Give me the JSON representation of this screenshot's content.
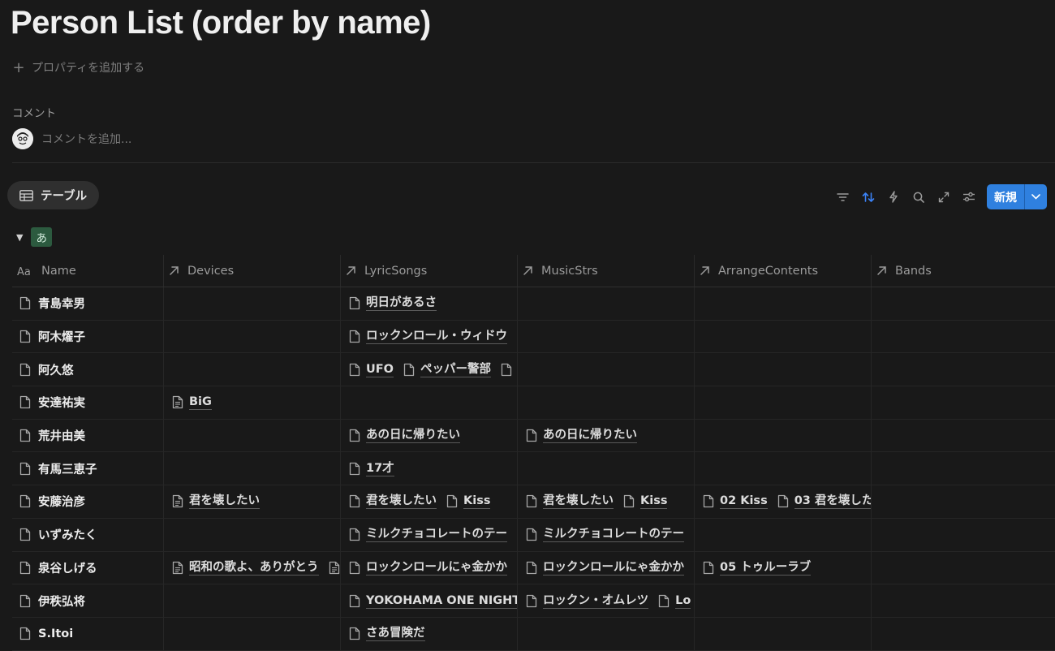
{
  "page": {
    "title": "Person List (order by name)"
  },
  "add_property": {
    "label": "プロパティを追加する"
  },
  "comments": {
    "label": "コメント",
    "placeholder": "コメントを追加..."
  },
  "view": {
    "tab_label": "テーブル"
  },
  "toolbar": {
    "new_label": "新規",
    "sort_active_color": "#3b82f6",
    "button_color": "#2f80df"
  },
  "group": {
    "label": "あ",
    "color": "#2c5a3f"
  },
  "table": {
    "columns": [
      {
        "label": "Name",
        "icon": "aa-text-icon"
      },
      {
        "label": "Devices",
        "icon": "relation-arrow-icon"
      },
      {
        "label": "LyricSongs",
        "icon": "relation-arrow-icon"
      },
      {
        "label": "MusicStrs",
        "icon": "relation-arrow-icon"
      },
      {
        "label": "ArrangeContents",
        "icon": "relation-arrow-icon"
      },
      {
        "label": "Bands",
        "icon": "relation-arrow-icon"
      }
    ],
    "rows": [
      {
        "name": "青島幸男",
        "devices": [],
        "lyric": [
          "明日があるさ"
        ],
        "music": [],
        "arrange": [],
        "bands": []
      },
      {
        "name": "阿木燿子",
        "devices": [],
        "lyric": [
          "ロックンロール・ウィドウ"
        ],
        "music": [],
        "arrange": [],
        "bands": []
      },
      {
        "name": "阿久悠",
        "devices": [],
        "lyric": [
          "UFO",
          "ペッパー警部",
          ""
        ],
        "music": [],
        "arrange": [],
        "bands": []
      },
      {
        "name": "安達祐実",
        "devices": [
          "BiG"
        ],
        "lyric": [],
        "music": [],
        "arrange": [],
        "bands": []
      },
      {
        "name": "荒井由美",
        "devices": [],
        "lyric": [
          "あの日に帰りたい"
        ],
        "music": [
          "あの日に帰りたい"
        ],
        "arrange": [],
        "bands": []
      },
      {
        "name": "有馬三恵子",
        "devices": [],
        "lyric": [
          "17才"
        ],
        "music": [],
        "arrange": [],
        "bands": []
      },
      {
        "name": "安藤治彦",
        "devices": [
          "君を壊したい"
        ],
        "lyric": [
          "君を壊したい",
          "Kiss"
        ],
        "music": [
          "君を壊したい",
          "Kiss"
        ],
        "arrange": [
          "02 Kiss",
          "03 君を壊した"
        ],
        "bands": []
      },
      {
        "name": "いずみたく",
        "devices": [],
        "lyric": [
          "ミルクチョコレートのテー"
        ],
        "music": [
          "ミルクチョコレートのテー"
        ],
        "arrange": [],
        "bands": []
      },
      {
        "name": "泉谷しげる",
        "devices": [
          "昭和の歌よ、ありがとう",
          ""
        ],
        "lyric": [
          "ロックンロールにゃ金かか"
        ],
        "music": [
          "ロックンロールにゃ金かか"
        ],
        "arrange": [
          "05 トゥルーラブ"
        ],
        "bands": []
      },
      {
        "name": "伊秩弘将",
        "devices": [],
        "lyric": [
          "YOKOHAMA ONE NIGHT"
        ],
        "music": [
          "ロックン・オムレツ",
          "Lo"
        ],
        "arrange": [],
        "bands": []
      },
      {
        "name": "S.Itoi",
        "devices": [],
        "lyric": [
          "さあ冒険だ"
        ],
        "music": [],
        "arrange": [],
        "bands": []
      }
    ]
  }
}
